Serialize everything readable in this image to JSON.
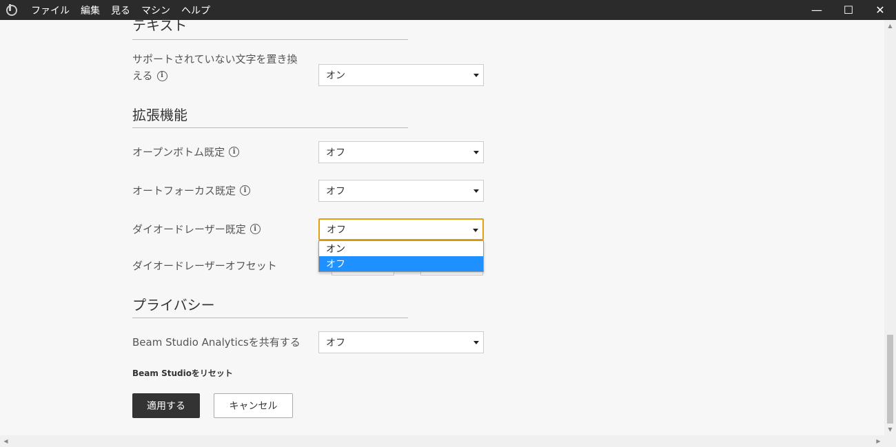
{
  "menu": {
    "items": [
      "ファイル",
      "編集",
      "見る",
      "マシン",
      "ヘルプ"
    ]
  },
  "window_controls": {
    "minimize": "—",
    "maximize": "☐",
    "close": "✕"
  },
  "sections": {
    "text": {
      "title": "テキスト",
      "replace_label_line1": "サポートされていない文字を置き換",
      "replace_label_line2": "える",
      "replace_value": "オン"
    },
    "extensions": {
      "title": "拡張機能",
      "open_bottom_label": "オープンボトム既定",
      "open_bottom_value": "オフ",
      "autofocus_label": "オートフォーカス既定",
      "autofocus_value": "オフ",
      "diode_label": "ダイオードレーザー既定",
      "diode_value": "オフ",
      "diode_offset_label": "ダイオードレーザーオフセット"
    },
    "privacy": {
      "title": "プライバシー",
      "analytics_label": "Beam Studio Analyticsを共有する",
      "analytics_value": "オフ"
    }
  },
  "dropdown": {
    "options": [
      "オン",
      "オフ"
    ],
    "selected": "オフ"
  },
  "reset_label": "Beam Studioをリセット",
  "buttons": {
    "apply": "適用する",
    "cancel": "キャンセル"
  },
  "info_glyph": "i",
  "colors": {
    "titlebar": "#2b2b2b",
    "accent_focus": "#e0a010",
    "selected_option": "#1e90ff",
    "primary_button": "#333333"
  }
}
